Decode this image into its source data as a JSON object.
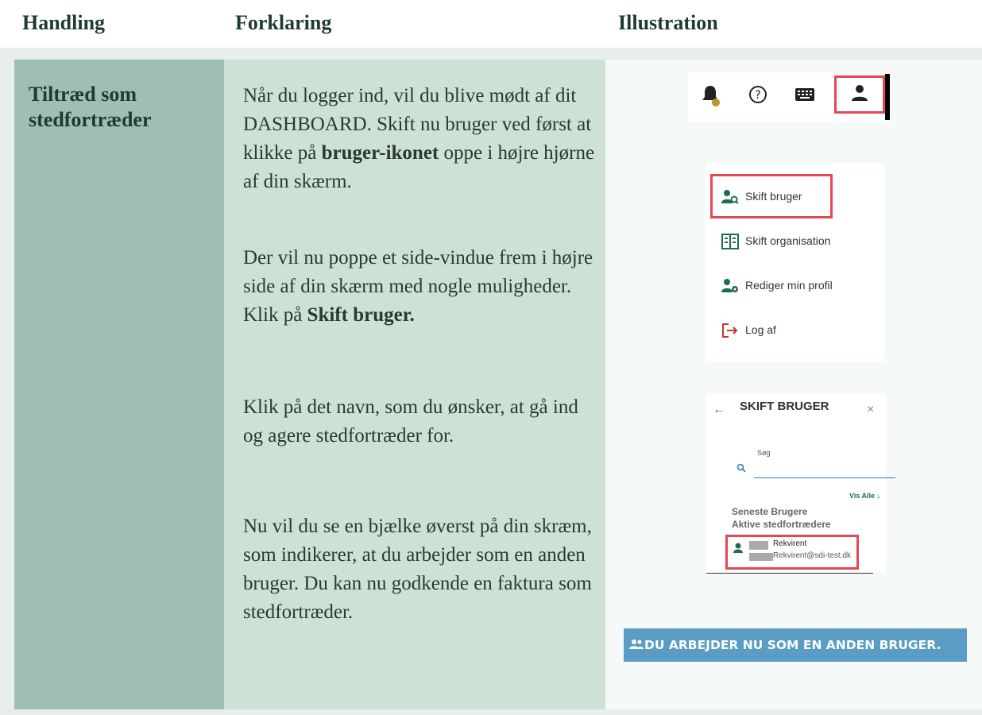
{
  "header": {
    "col1": "Handling",
    "col2": "Forklaring",
    "col3": "Illustration"
  },
  "row": {
    "action": "Tiltræd som stedfortræder",
    "paragraphs": {
      "p1a": "Når du logger ind, vil du blive mødt af dit DASHBOARD. Skift nu bruger ved først at klikke på ",
      "p1b": "bruger-ikonet",
      "p1c": " oppe i højre hjørne af din skærm.",
      "p2a": "Der vil nu poppe et side-vindue frem i højre side af din skærm med nogle muligheder. Klik på ",
      "p2b": "Skift bruger.",
      "p3": "Klik på det navn, som du ønsker, at gå ind og agere stedfortræder for.",
      "p4": "Nu vil du se en bjælke øverst på din skræm, som indikerer, at du arbejder som en anden bruger. Du kan nu godkende en faktura som stedfortræder."
    }
  },
  "illustration": {
    "icons": [
      "bell-icon",
      "help-icon",
      "keyboard-icon",
      "user-icon"
    ],
    "menu": [
      "Skift bruger",
      "Skift organisation",
      "Rediger min profil",
      "Log af"
    ],
    "skift_panel": {
      "title": "SKIFT BRUGER",
      "search_label": "Søg",
      "vis_alle": "Vis Alle",
      "recent_label": "Seneste Brugere",
      "active_label": "Aktive stedfortrædere",
      "user_name": "Rekvirent",
      "user_email": "Rekvirent@sdi-test.dk"
    },
    "banner": "DU ARBEJDER NU SOM EN ANDEN BRUGER."
  },
  "colors": {
    "accent_green": "#1e6e4e",
    "highlight_red": "#e8474f",
    "banner_blue": "#5a9cc4"
  }
}
